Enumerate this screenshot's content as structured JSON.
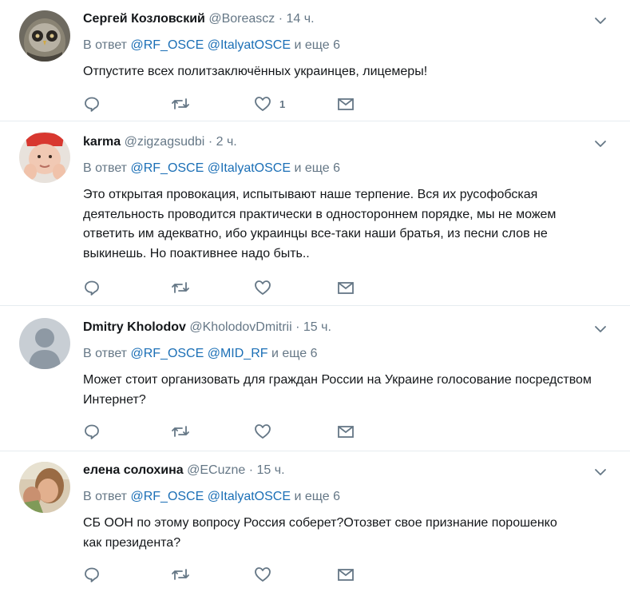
{
  "common": {
    "reply_prefix": "В ответ",
    "and_more_word": "и еще",
    "dot": "·"
  },
  "tweets": [
    {
      "name": "Сергей Козловский",
      "handle": "@Boreascz",
      "time": "14 ч.",
      "mentions": [
        "@RF_OSCE",
        "@ItalyatOSCE"
      ],
      "more": "6",
      "text": "Отпустите всех политзаключённых украинцев, лицемеры!",
      "like_count": "1"
    },
    {
      "name": "karma",
      "handle": "@zigzagsudbi",
      "time": "2 ч.",
      "mentions": [
        "@RF_OSCE",
        "@ItalyatOSCE"
      ],
      "more": "6",
      "text": "Это открытая провокация, испытывают наше терпение. Вся их русофобская деятельность проводится  практически в одностороннем порядке, мы не можем ответить им адекватно, ибо украинцы все-таки наши братья, из песни слов не выкинешь. Но поактивнее надо быть..",
      "like_count": ""
    },
    {
      "name": "Dmitry Kholodov",
      "handle": "@KholodovDmitrii",
      "time": "15 ч.",
      "mentions": [
        "@RF_OSCE",
        "@MID_RF"
      ],
      "more": "6",
      "text": "Может стоит организовать для граждан России на Украине голосование посредством Интернет?",
      "like_count": ""
    },
    {
      "name": "елена солохина",
      "handle": "@ECuzne",
      "time": "15 ч.",
      "mentions": [
        "@RF_OSCE",
        "@ItalyatOSCE"
      ],
      "more": "6",
      "text": "СБ ООН по этому вопросу Россия соберет?Отозвет свое признание порошенко как президента?",
      "like_count": ""
    }
  ],
  "icons": {
    "reply": "reply-icon",
    "retweet": "retweet-icon",
    "like": "heart-icon",
    "dm": "envelope-icon",
    "more": "chevron-down-icon"
  },
  "colors": {
    "text": "#14171a",
    "muted": "#657786",
    "link": "#1b6fb6",
    "divider": "#e6ecf0"
  }
}
